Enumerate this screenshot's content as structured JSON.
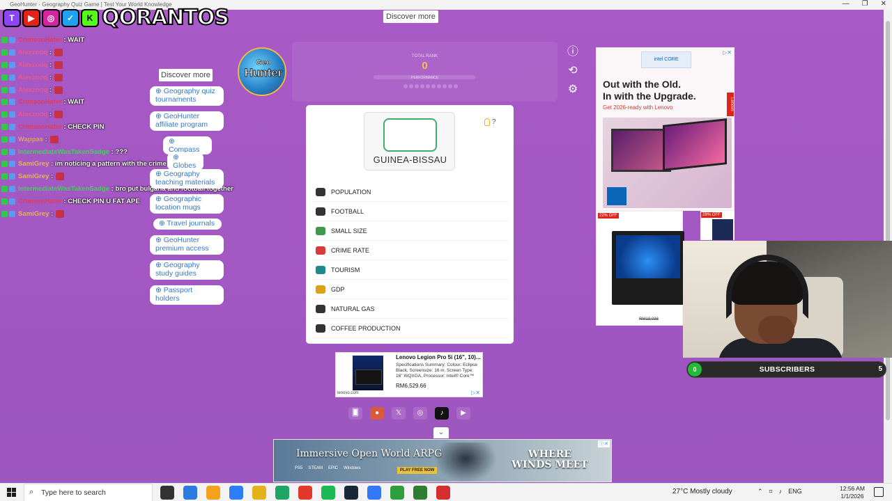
{
  "window": {
    "title": "GeoHunter - Geography Quiz Game | Test Your World Knowledge",
    "controls": [
      "—",
      "❐",
      "✕"
    ]
  },
  "overlay": {
    "brand": "QORANTOS",
    "social_badges": [
      "T",
      "▶",
      "◎",
      "✓",
      "K"
    ]
  },
  "chat": [
    {
      "user": "CrimsonHater",
      "text": "WAIT",
      "color": "#e23c58",
      "emote": false
    },
    {
      "user": "Alexzooq",
      "text": "",
      "color": "#e55a8a",
      "emote": true
    },
    {
      "user": "Alexzooq",
      "text": "",
      "color": "#e55a8a",
      "emote": true
    },
    {
      "user": "Alexzooq",
      "text": "",
      "color": "#e55a8a",
      "emote": true
    },
    {
      "user": "Alexzooq",
      "text": "",
      "color": "#e55a8a",
      "emote": true
    },
    {
      "user": "CrimsonHater",
      "text": "WAIT",
      "color": "#e23c58",
      "emote": false
    },
    {
      "user": "Alexzooq",
      "text": "",
      "color": "#e55a8a",
      "emote": true
    },
    {
      "user": "CrimsonHater",
      "text": "CHECK PIN",
      "color": "#e23c58",
      "emote": false
    },
    {
      "user": "Wappas",
      "text": "",
      "color": "#d8a35a",
      "emote": true
    },
    {
      "user": "IntermediateWasTakenSadge",
      "text": "???",
      "color": "#3fd15a",
      "emote": false
    },
    {
      "user": "SamiGrey",
      "text": "im noticing a pattern with the crime rate ones",
      "color": "#e8b44a",
      "emote": false
    },
    {
      "user": "SamiGrey",
      "text": "",
      "color": "#e8b44a",
      "emote": true
    },
    {
      "user": "IntermediateWasTakenSadge",
      "text": "bro put bulgaria and football together",
      "color": "#3fd15a",
      "emote": false
    },
    {
      "user": "CrimsonHater",
      "text": "CHECK PIN U FAT APE",
      "color": "#e23c58",
      "emote": false
    },
    {
      "user": "SamiGrey",
      "text": "",
      "color": "#e8b44a",
      "emote": true
    }
  ],
  "discover": {
    "top_label": "Discover more",
    "side_label": "Discover more",
    "links": [
      "⊕ Geography quiz tournaments",
      "⊕ GeoHunter affiliate program",
      "⊕ Compass",
      "⊕ Globes",
      "⊕ Geography teaching materials",
      "⊕ Geographic location mugs",
      "⊕ Travel journals",
      "⊕ GeoHunter premium access",
      "⊕ Geography study guides",
      "⊕ Passport holders"
    ]
  },
  "game": {
    "logo_line1": "Geo",
    "logo_line2": "Hunter",
    "rank_label": "TOTAL RANK",
    "rank_value": "0",
    "performance_label": "PERFORMANCE",
    "icons": [
      "info-icon",
      "refresh-icon",
      "settings-icon"
    ],
    "country": "GUINEA-BISSAU",
    "hint_label": "?",
    "categories": [
      {
        "label": "POPULATION",
        "icon": "people-icon",
        "color": "#333333"
      },
      {
        "label": "FOOTBALL",
        "icon": "football-icon",
        "color": "#333333"
      },
      {
        "label": "SMALL SIZE",
        "icon": "size-icon",
        "color": "#3b9a4b"
      },
      {
        "label": "CRIME RATE",
        "icon": "crime-icon",
        "color": "#d93a3a"
      },
      {
        "label": "TOURISM",
        "icon": "tourism-icon",
        "color": "#1f8a8a"
      },
      {
        "label": "GDP",
        "icon": "gdp-icon",
        "color": "#d9a21a"
      },
      {
        "label": "NATURAL GAS",
        "icon": "gas-icon",
        "color": "#333333"
      },
      {
        "label": "COFFEE PRODUCTION",
        "icon": "coffee-icon",
        "color": "#333333"
      }
    ]
  },
  "ad_right": {
    "intel_label": "intel CORE",
    "headline_1": "Out with the Old.",
    "headline_2": "In with the Upgrade.",
    "sub": "Get 2026-ready with Lenovo",
    "tab": "Lenovo",
    "adchoice": "▷✕",
    "off_1": "22% OFF",
    "off_2": "28% OFF",
    "price": "RM18,038"
  },
  "subscribers": {
    "count": "0",
    "label": "SUBSCRIBERS",
    "goal": "5"
  },
  "ad_mid": {
    "title": "Lenovo Legion Pro 5i (16\", 10)...",
    "desc": "Specifications Summary: Colour: Eclipse Black, Screensize: 16 in, Screen Type: 16\" WQXGA, Processor: Intel® Core™",
    "price": "RM6,529.66",
    "url": "lenovo.com",
    "adchoice": "▷✕"
  },
  "socials": [
    "🂠",
    "●",
    "𝕏",
    "◎",
    "♪",
    "▶"
  ],
  "chevron": "⌄",
  "banner": {
    "left": "Immersive Open World ARPG",
    "platforms": [
      "PS5",
      "STEAM",
      "EPIC",
      "Windows"
    ],
    "play": "PLAY FREE NOW",
    "right": "WHERE WINDS MEET",
    "adchoice": "ⓘ✕"
  },
  "taskbar": {
    "search_placeholder": "Type here to search",
    "weather": "27°C  Mostly cloudy",
    "lang": "ENG",
    "time": "12:56 AM",
    "date": "1/1/2026",
    "app_colors": [
      "#333333",
      "#2a7ae2",
      "#f4a11d",
      "#2d7df6",
      "#e3b21a",
      "#1fa463",
      "#e2382c",
      "#1db954",
      "#1b2838",
      "#3478f6",
      "#2e9e3e",
      "#2e7d32",
      "#d32f2f"
    ]
  }
}
